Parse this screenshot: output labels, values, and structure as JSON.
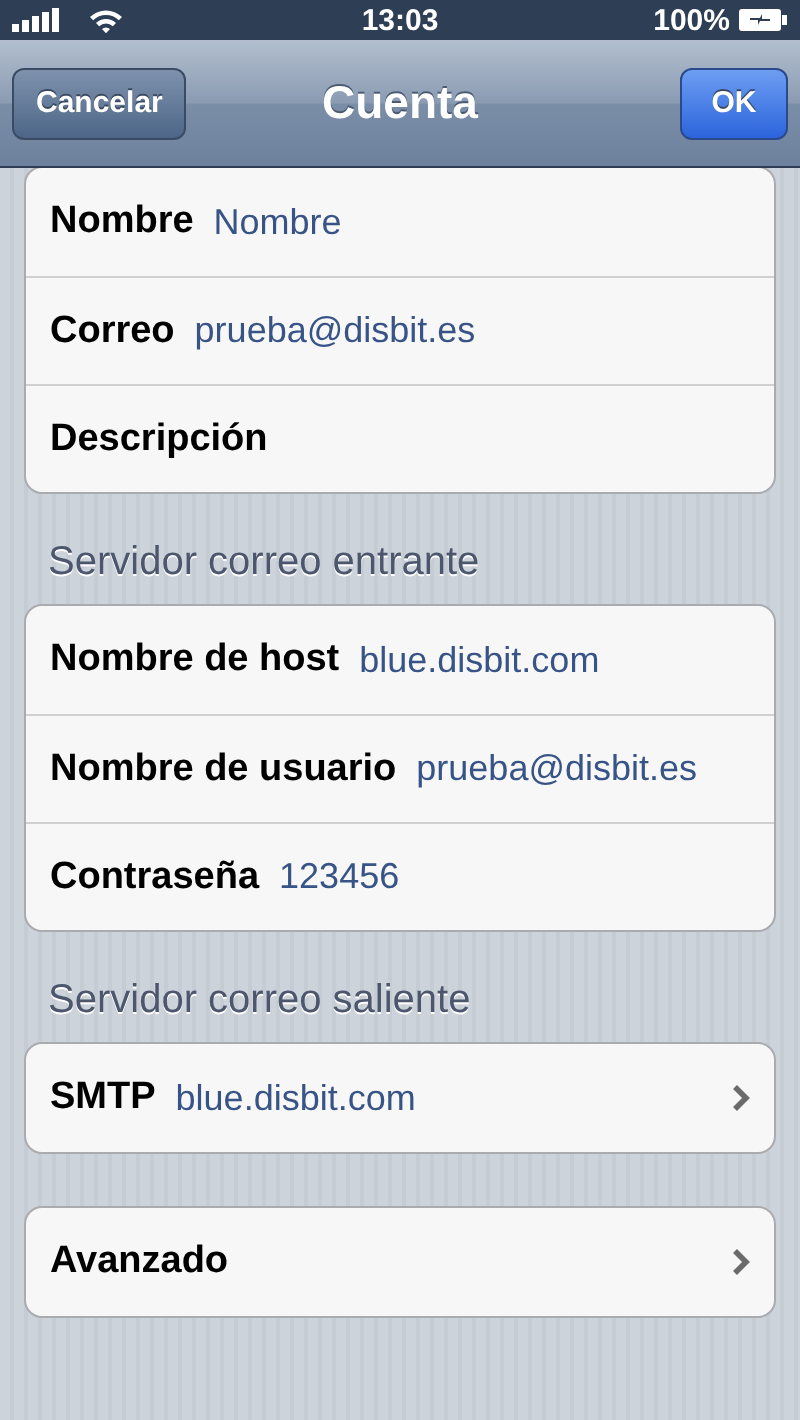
{
  "status_bar": {
    "time": "13:03",
    "battery": "100%"
  },
  "nav_bar": {
    "title": "Cuenta",
    "left_button": "Cancelar",
    "right_button": "OK"
  },
  "groups": [
    {
      "rows": [
        {
          "kind": "field",
          "label": "Nombre",
          "value": "Nombre"
        },
        {
          "kind": "field",
          "label": "Correo",
          "value": "prueba@disbit.es"
        },
        {
          "kind": "field",
          "label": "Descripción"
        }
      ]
    },
    {
      "header": "Servidor correo entrante",
      "rows": [
        {
          "kind": "field",
          "label": "Nombre de host",
          "value": "blue.disbit.com"
        },
        {
          "kind": "field",
          "label": "Nombre de usuario",
          "value": "prueba@disbit.es"
        },
        {
          "kind": "field",
          "label": "Contraseña",
          "value": "123456"
        }
      ]
    },
    {
      "header": "Servidor correo saliente",
      "rows": [
        {
          "kind": "link",
          "label": "SMTP",
          "value": "blue.disbit.com"
        }
      ]
    },
    {
      "rows": [
        {
          "kind": "link",
          "label": "Avanzado"
        }
      ]
    }
  ]
}
